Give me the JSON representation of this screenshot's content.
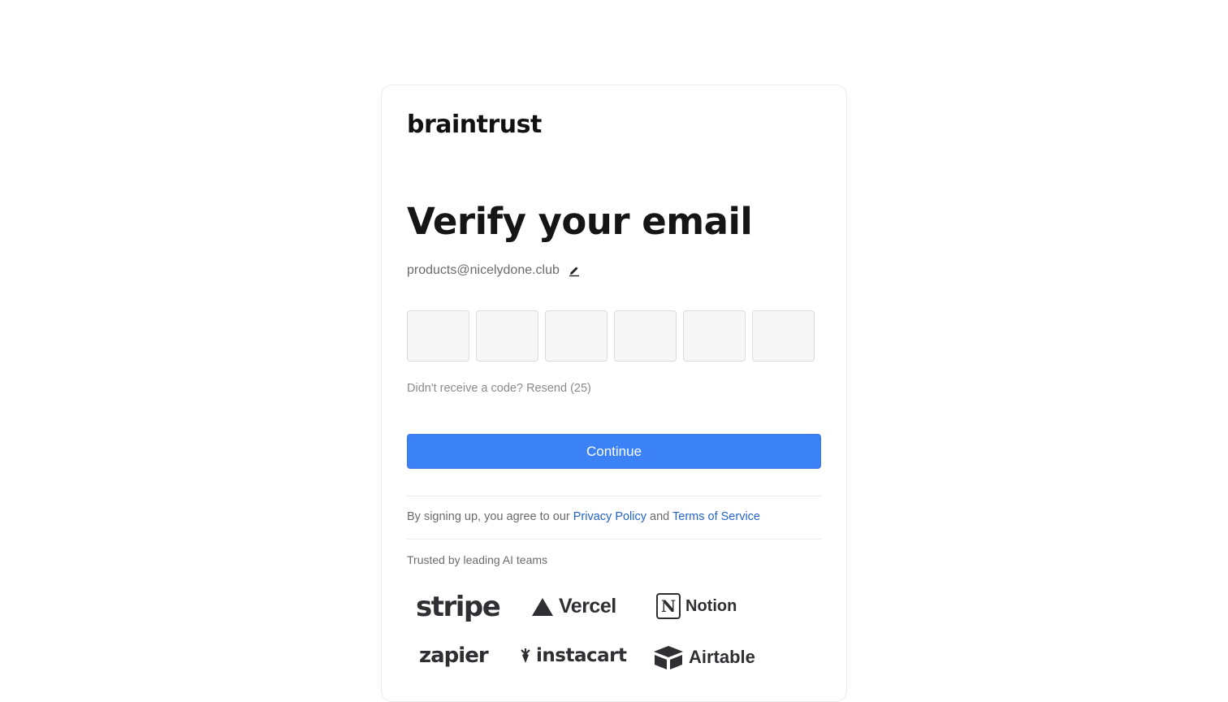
{
  "brand": {
    "logo_text": "braintrust"
  },
  "verify": {
    "title": "Verify your email",
    "email": "products@nicelydone.club",
    "code_digits": [
      "",
      "",
      "",
      "",
      "",
      ""
    ],
    "resend_prefix": "Didn't receive a code?",
    "resend_link": "Resend (25)",
    "continue_label": "Continue"
  },
  "legal": {
    "prefix": "By signing up, you agree to our",
    "privacy_label": "Privacy Policy",
    "and": "and",
    "terms_label": "Terms of Service"
  },
  "trusted": {
    "label": "Trusted by leading AI teams",
    "logos": [
      "stripe",
      "Vercel",
      "Notion",
      "zapier",
      "instacart",
      "Airtable"
    ]
  },
  "colors": {
    "primary_button": "#3b82f6",
    "link": "#2563c9"
  }
}
